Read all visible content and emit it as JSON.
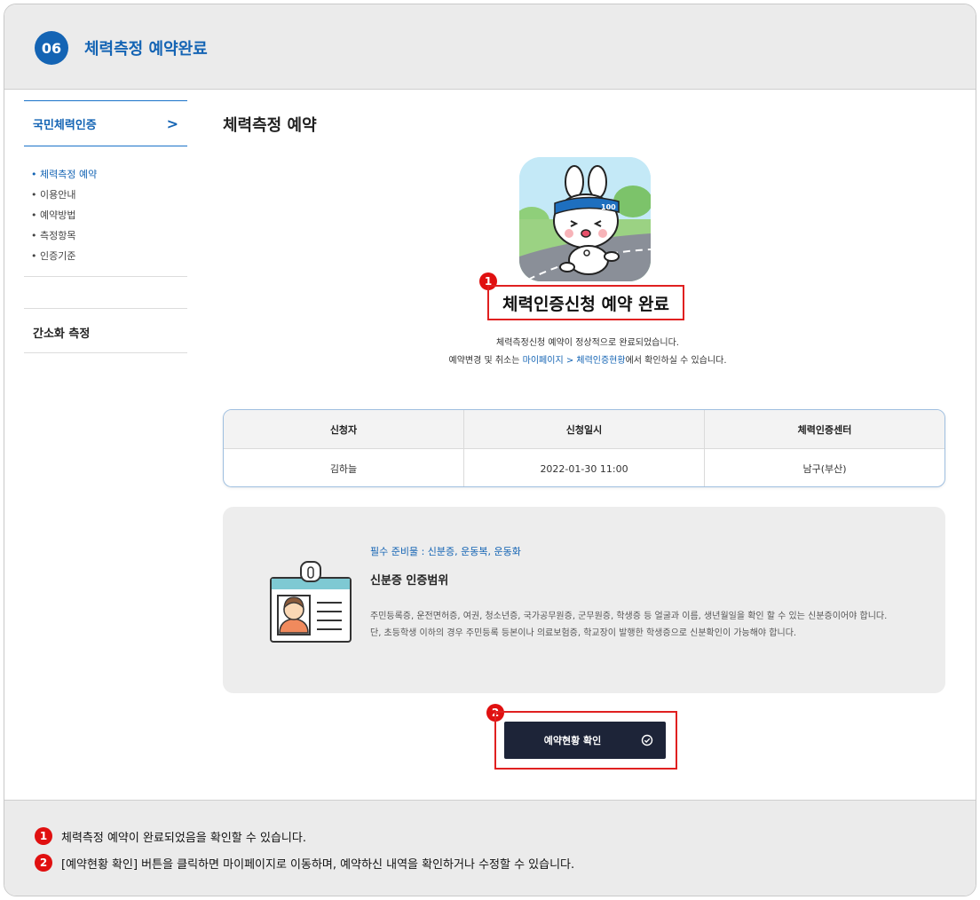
{
  "step": {
    "number": "06",
    "title": "체력측정 예약완료"
  },
  "sidebar": {
    "section_title": "국민체력인증",
    "items": [
      "• 체력측정 예약",
      "• 이용안내",
      "• 예약방법",
      "• 측정항목",
      "• 인증기준"
    ],
    "sub_section": "간소화 측정"
  },
  "main": {
    "title": "체력측정 예약",
    "complete_text": "체력인증신청 예약 완료",
    "desc_line1": "체력측정신청 예약이 정상적으로 완료되었습니다.",
    "desc_line2_prefix": "예약변경 및 취소는 ",
    "desc_line2_link": "마이페이지 > 체력인증현황",
    "desc_line2_suffix": "에서 확인하실 수 있습니다.",
    "table": {
      "headers": [
        "신청자",
        "신청일시",
        "체력인증센터"
      ],
      "row": [
        "김하늘",
        "2022-01-30 11:00",
        "남구(부산)"
      ]
    },
    "info": {
      "required": "필수 준비물 : 신분증, 운동복, 운동화",
      "subtitle": "신분증 인증범위",
      "body": "주민등록증, 운전면허증, 여권, 청소년증, 국가공무원증, 군무원증, 학생증 등 얼굴과 이름, 생년월일을 확인 할 수 있는 신분증이어야 합니다. 단, 초등학생 이하의 경우 주민등록 등본이나 의료보험증, 학교장이 발행한 학생증으로 신분확인이 가능해야 합니다."
    },
    "button_label": "예약현황 확인",
    "character_band_text": "100"
  },
  "callouts": [
    "1",
    "2"
  ],
  "notes": [
    {
      "num": "1",
      "text": "체력측정 예약이 완료되었음을 확인할 수 있습니다."
    },
    {
      "num": "2",
      "text": "[예약현황 확인] 버튼을 클릭하면 마이페이지로 이동하며, 예약하신 내역을 확인하거나 수정할 수 있습니다."
    }
  ],
  "colors": {
    "accent": "#1464b4",
    "callout": "#e01010",
    "button": "#1d2438"
  }
}
